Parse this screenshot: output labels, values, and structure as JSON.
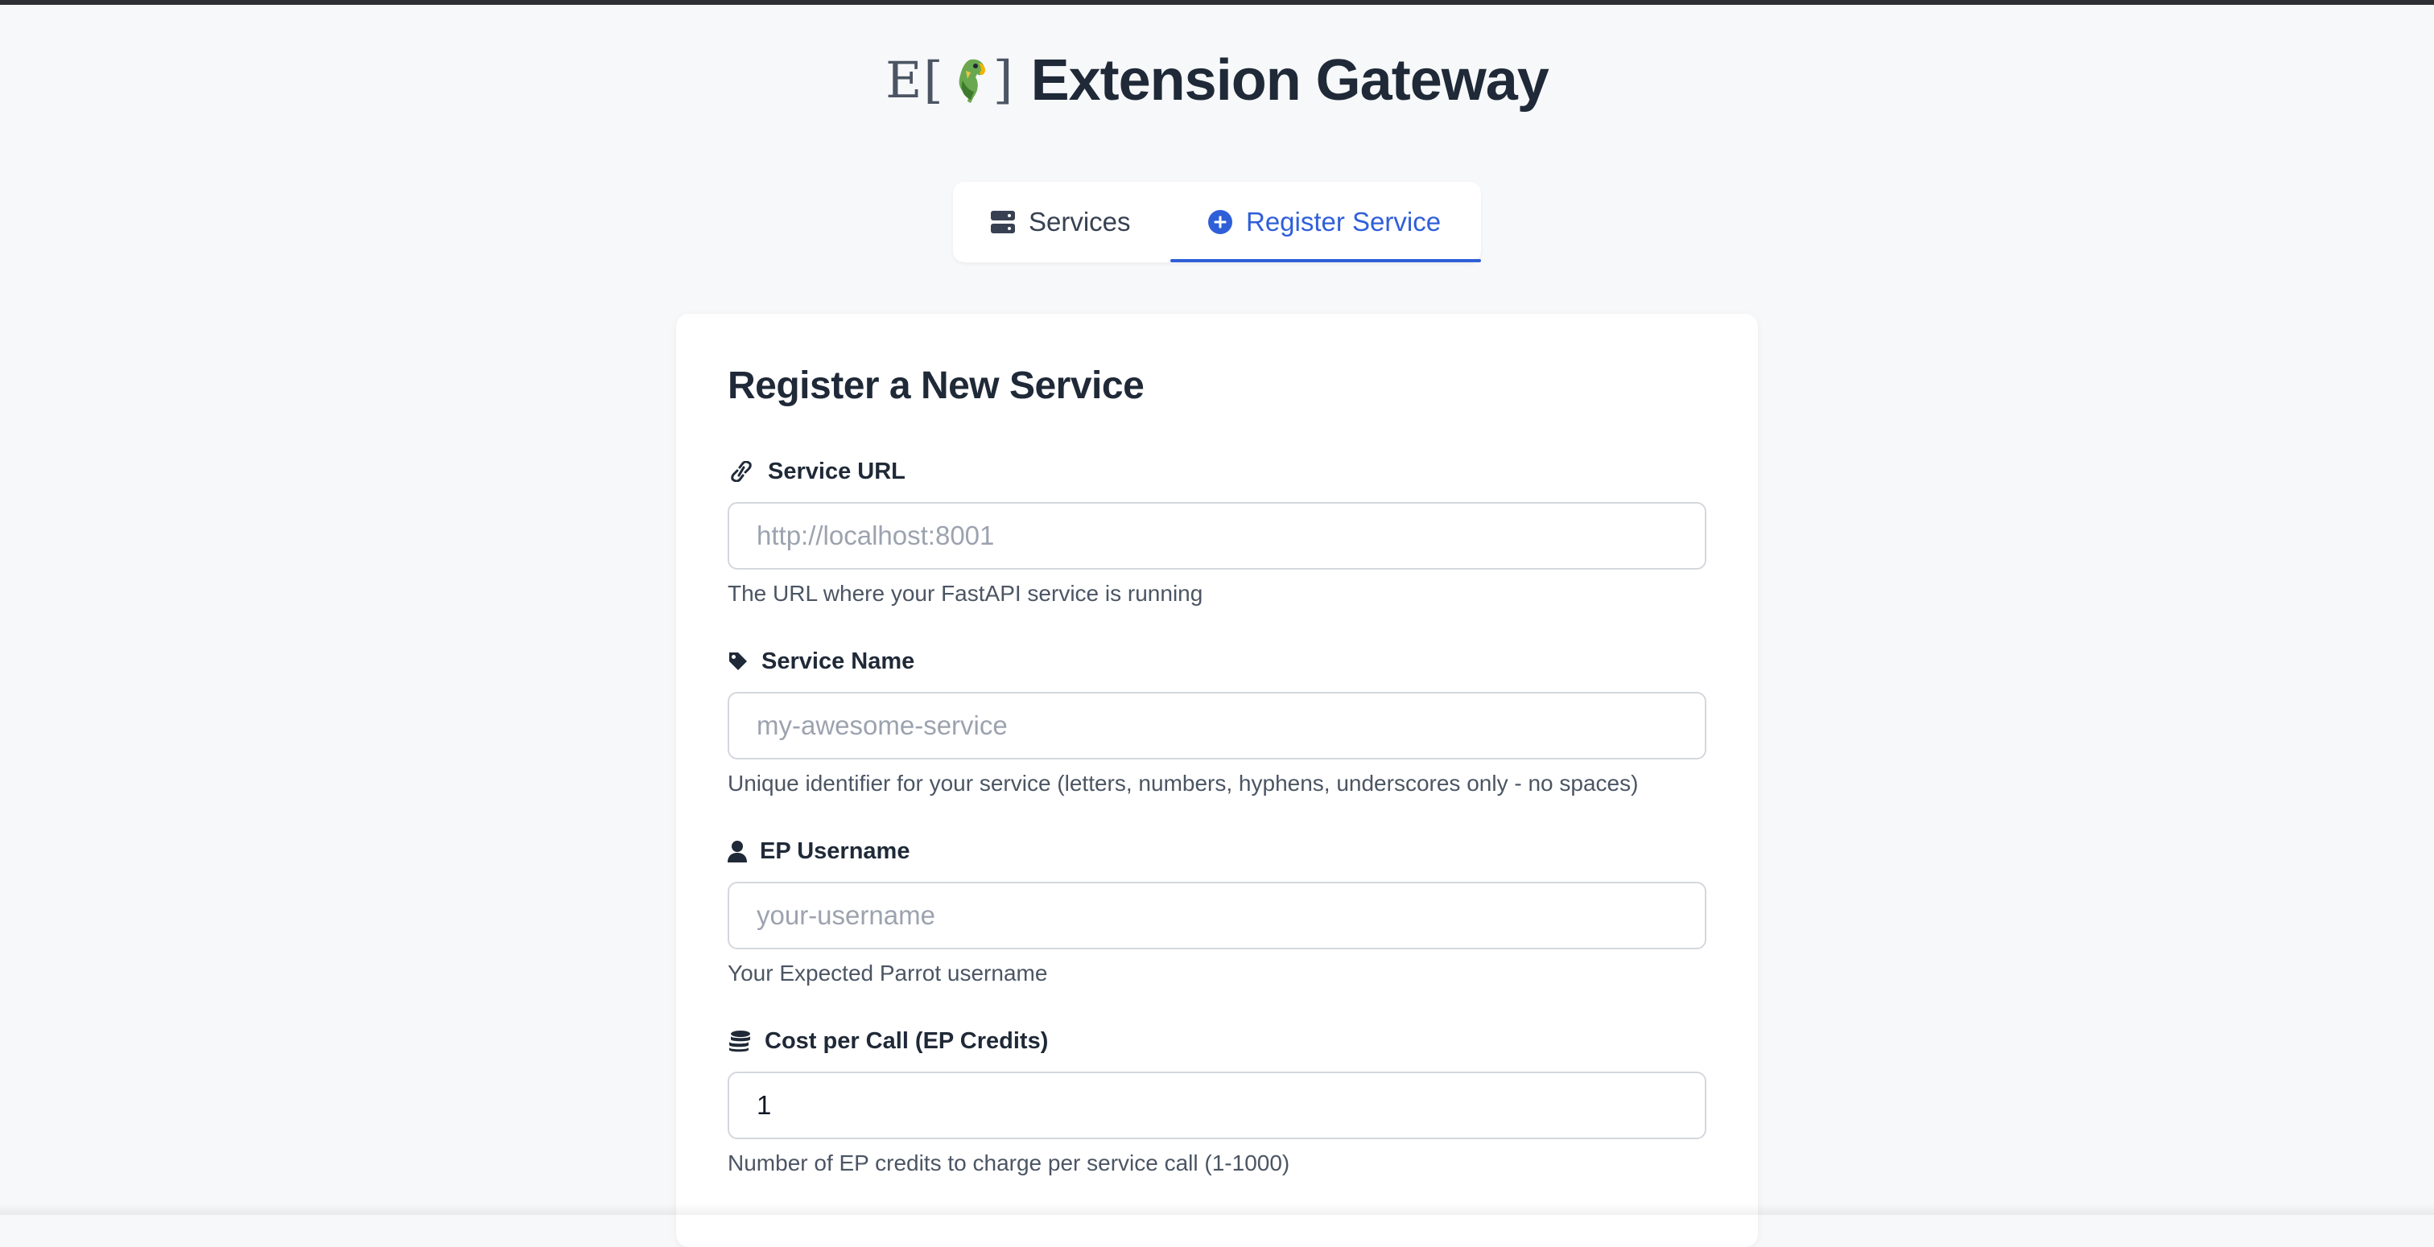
{
  "brand": {
    "logo_text_left": "E[",
    "logo_text_right": "]",
    "logo_icon": "parrot-icon",
    "title": "Extension Gateway"
  },
  "tabs": [
    {
      "label": "Services",
      "icon": "server-icon",
      "active": false
    },
    {
      "label": "Register Service",
      "icon": "plus-circle-icon",
      "active": true
    }
  ],
  "form": {
    "title": "Register a New Service",
    "fields": {
      "service_url": {
        "label": "Service URL",
        "icon": "link-icon",
        "placeholder": "http://localhost:8001",
        "value": "",
        "help": "The URL where your FastAPI service is running"
      },
      "service_name": {
        "label": "Service Name",
        "icon": "tag-icon",
        "placeholder": "my-awesome-service",
        "value": "",
        "help": "Unique identifier for your service (letters, numbers, hyphens, underscores only - no spaces)"
      },
      "ep_username": {
        "label": "EP Username",
        "icon": "user-icon",
        "placeholder": "your-username",
        "value": "",
        "help": "Your Expected Parrot username"
      },
      "cost_per_call": {
        "label": "Cost per Call (EP Credits)",
        "icon": "coins-icon",
        "placeholder": "",
        "value": "1",
        "help": "Number of EP credits to charge per service call (1-1000)"
      }
    }
  },
  "colors": {
    "accent": "#2f5fd8",
    "background": "#f7f8fa",
    "text": "#1f2937",
    "muted": "#4b5563"
  }
}
